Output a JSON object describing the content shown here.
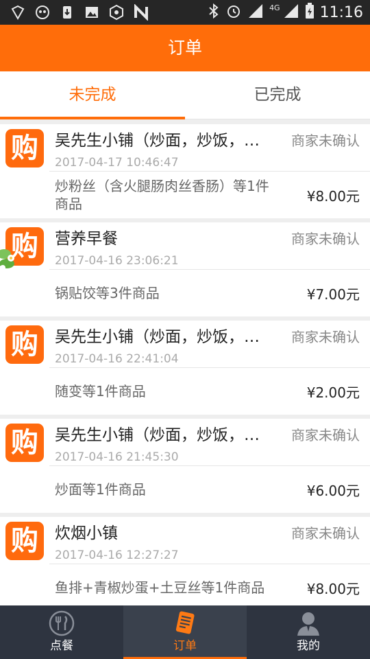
{
  "status_bar": {
    "network": "4G",
    "time": "11:16",
    "left_icons": [
      "shield-icon",
      "face-icon",
      "download-icon",
      "image-icon",
      "hexagon-icon",
      "n-icon"
    ],
    "right_icons": [
      "bluetooth-icon",
      "alarm-icon",
      "wifi-signal-icon",
      "cell-signal-icon",
      "battery-icon"
    ]
  },
  "header": {
    "title": "订单"
  },
  "tabs": [
    {
      "label": "未完成",
      "active": true
    },
    {
      "label": "已完成",
      "active": false
    }
  ],
  "orders": [
    {
      "shop": "吴先生小铺（炒面，炒饭，…",
      "status": "商家未确认",
      "time": "2017-04-17 10:46:47",
      "items": "炒粉丝（含火腿肠肉丝香肠）等1件商品",
      "price": "¥8.00元"
    },
    {
      "shop": "营养早餐",
      "status": "商家未确认",
      "time": "2017-04-16 23:06:21",
      "items": "锅贴饺等3件商品",
      "price": "¥7.00元"
    },
    {
      "shop": "吴先生小铺（炒面，炒饭，…",
      "status": "商家未确认",
      "time": "2017-04-16 22:41:04",
      "items": "随变等1件商品",
      "price": "¥2.00元"
    },
    {
      "shop": "吴先生小铺（炒面，炒饭，…",
      "status": "商家未确认",
      "time": "2017-04-16 21:45:30",
      "items": "炒面等1件商品",
      "price": "¥6.00元"
    },
    {
      "shop": "炊烟小镇",
      "status": "商家未确认",
      "time": "2017-04-16 12:27:27",
      "items": "鱼排+青椒炒蛋+土豆丝等1件商品",
      "price": "¥8.00元"
    }
  ],
  "shop_icon_glyph": "购",
  "bottom_nav": [
    {
      "label": "点餐",
      "icon": "fork-knife-icon",
      "active": false
    },
    {
      "label": "订单",
      "icon": "receipt-icon",
      "active": true
    },
    {
      "label": "我的",
      "icon": "user-icon",
      "active": false
    }
  ],
  "colors": {
    "accent": "#ff6d0a",
    "nav_bg": "#2e3440",
    "status_bar": "#262626"
  }
}
